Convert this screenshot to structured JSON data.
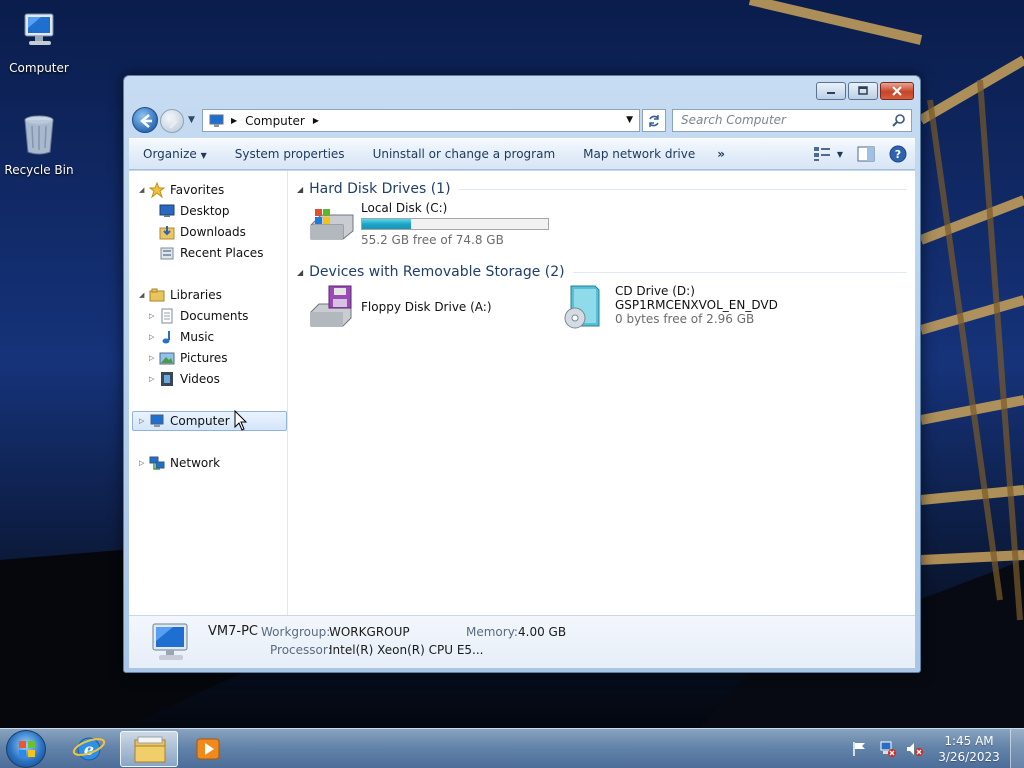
{
  "desktop": {
    "icons": [
      {
        "label": "Computer"
      },
      {
        "label": "Recycle Bin"
      }
    ]
  },
  "window": {
    "address": {
      "segment": "Computer"
    },
    "search_placeholder": "Search Computer",
    "commands": {
      "organize": "Organize",
      "system_properties": "System properties",
      "uninstall": "Uninstall or change a program",
      "map_drive": "Map network drive",
      "more": "»"
    },
    "nav": {
      "favorites": "Favorites",
      "desktop": "Desktop",
      "downloads": "Downloads",
      "recent": "Recent Places",
      "libraries": "Libraries",
      "documents": "Documents",
      "music": "Music",
      "pictures": "Pictures",
      "videos": "Videos",
      "computer": "Computer",
      "network": "Network"
    },
    "groups": {
      "hdd": "Hard Disk Drives (1)",
      "removable": "Devices with Removable Storage (2)"
    },
    "drives": {
      "c": {
        "name": "Local Disk (C:)",
        "free": "55.2 GB free of 74.8 GB",
        "used_fraction": 0.262
      },
      "a": {
        "name": "Floppy Disk Drive (A:)"
      },
      "d": {
        "name": "CD Drive (D:)",
        "label": "GSP1RMCENXVOL_EN_DVD",
        "free": "0 bytes free of 2.96 GB"
      }
    },
    "details": {
      "pc_name": "VM7-PC",
      "workgroup_label": "Workgroup:",
      "workgroup": "WORKGROUP",
      "memory_label": "Memory:",
      "memory": "4.00 GB",
      "processor_label": "Processor:",
      "processor": "Intel(R) Xeon(R) CPU E5..."
    }
  },
  "taskbar": {
    "time": "1:45 AM",
    "date": "3/26/2023"
  },
  "colors": {
    "accent": "#1e3f6b",
    "selection": "#d4e6fa",
    "disk_fill": "#1ea5c6"
  }
}
